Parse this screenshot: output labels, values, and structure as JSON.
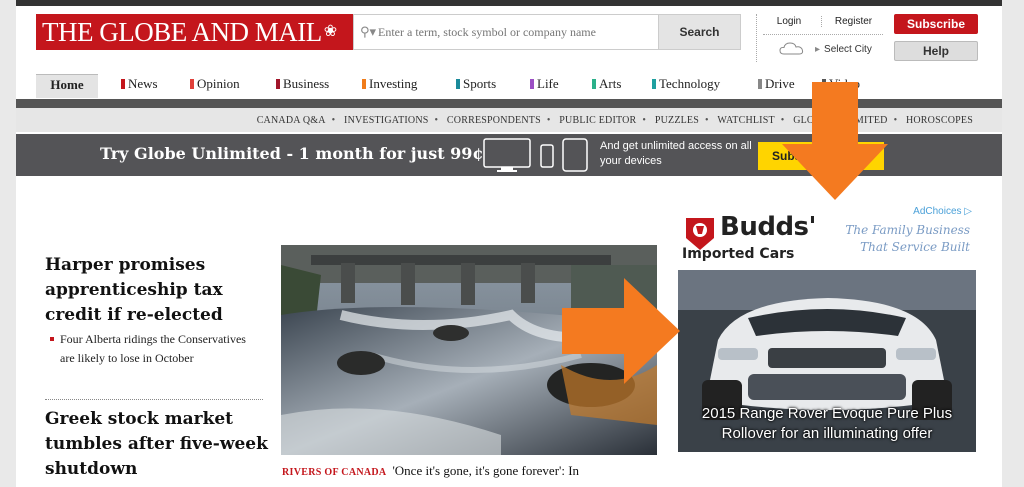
{
  "header": {
    "logo": "THE GLOBE AND MAIL",
    "search_placeholder": "Enter a term, stock symbol or company name",
    "search_button": "Search",
    "login": "Login",
    "register": "Register",
    "select_city": "Select City",
    "subscribe": "Subscribe",
    "help": "Help"
  },
  "nav": {
    "items": [
      {
        "label": "Home"
      },
      {
        "label": "News",
        "color": "#c4161c"
      },
      {
        "label": "Opinion",
        "color": "#e0403a"
      },
      {
        "label": "Business",
        "color": "#a1162a"
      },
      {
        "label": "Investing",
        "color": "#f07c1a"
      },
      {
        "label": "Sports",
        "color": "#1a8a9a"
      },
      {
        "label": "Life",
        "color": "#9b4fc4"
      },
      {
        "label": "Arts",
        "color": "#2bb08a"
      },
      {
        "label": "Technology",
        "color": "#1fa0a0"
      },
      {
        "label": "Drive",
        "color": "#888888"
      },
      {
        "label": "Video",
        "color": "#555555"
      }
    ]
  },
  "subnav": {
    "links": [
      "CANADA Q&A",
      "INVESTIGATIONS",
      "CORRESPONDENTS",
      "PUBLIC EDITOR",
      "PUZZLES",
      "WATCHLIST",
      "GLOBE UNLIMITED",
      "HOROSCOPES"
    ]
  },
  "promo": {
    "headline": "Try Globe Unlimited - 1 month for just 99¢",
    "copy": "And get unlimited access on all your devices",
    "cta": "Subscribe now"
  },
  "stories": {
    "lead_headline": "Harper promises apprenticeship tax credit if re-elected",
    "lead_bullet": "Four Alberta ridings the Conservatives are likely to lose in October",
    "second_headline": "Greek stock market tumbles after five-week shutdown",
    "photo_kicker": "RIVERS OF CANADA",
    "photo_caption": "'Once it's gone, it's gone forever': In"
  },
  "ad": {
    "adchoices": "AdChoices",
    "brand": "Budds'",
    "brand_sub": "Imported Cars",
    "tagline_1": "The Family Business",
    "tagline_2": "That Service Built",
    "offer_1": "2015 Range Rover Evoque Pure Plus",
    "offer_2": "Rollover for an illuminating offer"
  },
  "colors": {
    "brand_red": "#c4161c",
    "arrow_orange": "#f47a20",
    "cta_yellow": "#ffd400",
    "promo_gray": "#545457"
  }
}
